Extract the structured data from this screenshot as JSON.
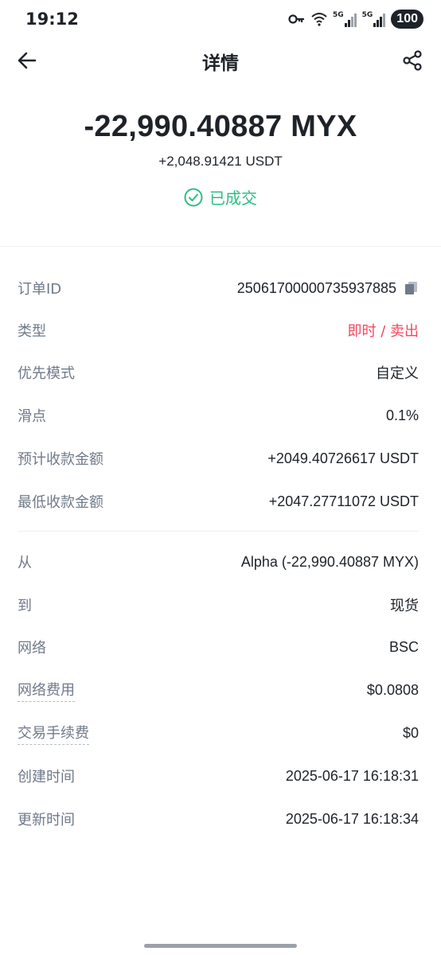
{
  "status_bar": {
    "time": "19:12",
    "battery": "100",
    "network1": "5G",
    "network2": "5G"
  },
  "header": {
    "title": "详情"
  },
  "summary": {
    "amount": "-22,990.40887 MYX",
    "sub_amount": "+2,048.91421 USDT",
    "status": "已成交",
    "status_color": "#2ebd85"
  },
  "details": {
    "order_id": {
      "label": "订单ID",
      "value": "25061700000735937885"
    },
    "type": {
      "label": "类型",
      "value": "即时 / 卖出",
      "color": "#f6465d"
    },
    "priority_mode": {
      "label": "优先模式",
      "value": "自定义"
    },
    "slippage": {
      "label": "滑点",
      "value": "0.1%"
    },
    "expected_receive": {
      "label": "预计收款金额",
      "value": "+2049.40726617 USDT"
    },
    "min_receive": {
      "label": "最低收款金额",
      "value": "+2047.27711072 USDT"
    },
    "from": {
      "label": "从",
      "value": "Alpha (-22,990.40887 MYX)"
    },
    "to": {
      "label": "到",
      "value": "现货"
    },
    "network": {
      "label": "网络",
      "value": "BSC"
    },
    "network_fee": {
      "label": "网络费用",
      "value": "$0.0808"
    },
    "trading_fee": {
      "label": "交易手续费",
      "value": "$0"
    },
    "created_time": {
      "label": "创建时间",
      "value": "2025-06-17 16:18:31"
    },
    "updated_time": {
      "label": "更新时间",
      "value": "2025-06-17 16:18:34"
    }
  }
}
